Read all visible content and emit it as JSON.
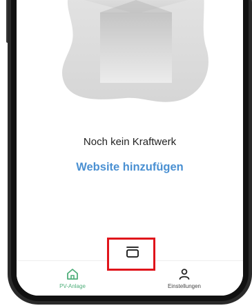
{
  "empty_state": {
    "message": "Noch kein Kraftwerk",
    "action_label": "Website hinzufügen",
    "illustration": "empty-box-illustration"
  },
  "tabbar": {
    "tabs": [
      {
        "label": "PV-Anlage",
        "icon": "home-icon",
        "active": true,
        "color": "#4fae7a"
      },
      {
        "label": "",
        "icon": "layers-icon",
        "highlighted": true,
        "highlight_color": "#e0141b"
      },
      {
        "label": "Einstellungen",
        "icon": "user-icon",
        "active": false
      }
    ]
  },
  "colors": {
    "link": "#4a90d2",
    "active_tab": "#4fae7a",
    "highlight": "#e0141b"
  }
}
